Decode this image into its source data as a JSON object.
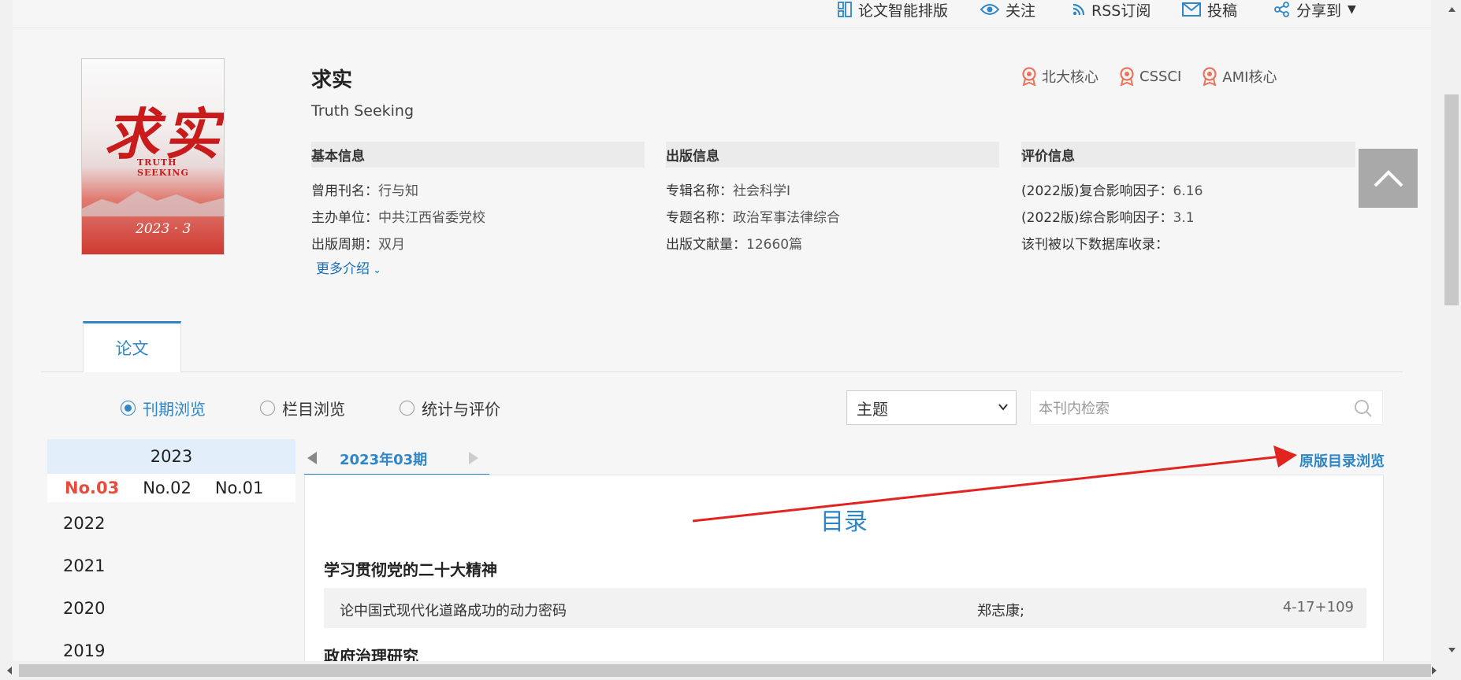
{
  "toolbar": {
    "layout": "论文智能排版",
    "follow": "关注",
    "rss": "RSS订阅",
    "submit": "投稿",
    "share": "分享到"
  },
  "journal": {
    "cover": {
      "title_cn": "求实",
      "title_en": "TRUTH SEEKING",
      "issue": "2023 · 3"
    },
    "title": "求实",
    "title_en": "Truth Seeking",
    "badges": [
      "北大核心",
      "CSSCI",
      "AMI核心"
    ]
  },
  "basic": {
    "header": "基本信息",
    "former_name_label": "曾用刊名：",
    "former_name": "行与知",
    "sponsor_label": "主办单位：",
    "sponsor": "中共江西省委党校",
    "cycle_label": "出版周期：",
    "cycle": "双月",
    "more": "更多介绍"
  },
  "publishing": {
    "header": "出版信息",
    "album_label": "专辑名称：",
    "album": "社会科学I",
    "topic_label": "专题名称：",
    "topic": "政治军事法律综合",
    "count_label": "出版文献量：",
    "count": "12660篇"
  },
  "evaluation": {
    "header": "评价信息",
    "composite_label": "(2022版)复合影响因子：",
    "composite": "6.16",
    "comprehensive_label": "(2022版)综合影响因子：",
    "comprehensive": "3.1",
    "db_label": "该刊被以下数据库收录："
  },
  "tabs": {
    "papers": "论文"
  },
  "browse": {
    "options": [
      "刊期浏览",
      "栏目浏览",
      "统计与评价"
    ],
    "selected": "刊期浏览",
    "select_value": "主题",
    "search_placeholder": "本刊内检索"
  },
  "years": {
    "active": "2023",
    "issues": [
      "No.03",
      "No.02",
      "No.01"
    ],
    "current_issue": "No.03",
    "others": [
      "2022",
      "2021",
      "2020",
      "2019"
    ]
  },
  "issue_nav": {
    "current": "2023年03期",
    "original_toc": "原版目录浏览"
  },
  "toc": {
    "heading": "目录",
    "sections": [
      {
        "name": "学习贯彻党的二十大精神",
        "articles": [
          {
            "title": "论中国式现代化道路成功的动力密码",
            "author": "郑志康;",
            "pages": "4-17+109"
          }
        ]
      },
      {
        "name": "政府治理研究",
        "articles": []
      }
    ]
  },
  "colors": {
    "accent": "#2e86c7",
    "current_issue": "#e74c3c",
    "annotation_arrow": "#e0241f"
  }
}
